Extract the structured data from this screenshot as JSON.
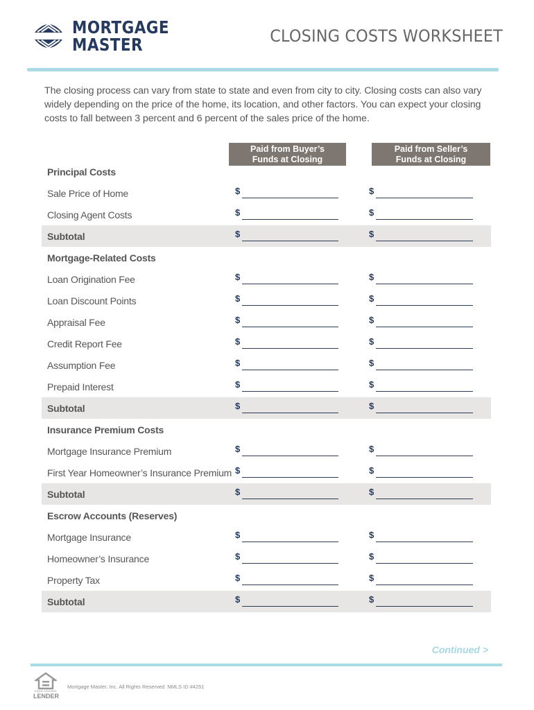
{
  "brand": {
    "line1": "MORTGAGE",
    "line2": "MASTER",
    "color": "#253a5e",
    "logo_icon": "globe-icon"
  },
  "document": {
    "title": "CLOSING COSTS WORKSHEET",
    "intro": "The closing process can vary from state to state and even from city to city. Closing costs can also vary widely depending on the price of the home, its location, and other factors. You can expect your closing costs to fall between 3 percent and 6 percent of the sales price of the home.",
    "accent_color": "#a9dbe6"
  },
  "columns": {
    "buyer": {
      "line1": "Paid from Buyer’s",
      "line2": "Funds at Closing"
    },
    "seller": {
      "line1": "Paid from Seller’s",
      "line2": "Funds at Closing"
    },
    "currency_symbol": "$"
  },
  "sections": [
    {
      "title": "Principal Costs",
      "items": [
        "Sale Price of Home",
        "Closing Agent Costs"
      ],
      "subtotal_label": "Subtotal"
    },
    {
      "title": "Mortgage-Related Costs",
      "items": [
        "Loan Origination Fee",
        "Loan Discount Points",
        "Appraisal Fee",
        "Credit Report Fee",
        "Assumption Fee",
        "Prepaid Interest"
      ],
      "subtotal_label": "Subtotal"
    },
    {
      "title": "Insurance Premium Costs",
      "items": [
        "Mortgage Insurance Premium",
        "First Year Homeowner’s Insurance Premium"
      ],
      "subtotal_label": "Subtotal"
    },
    {
      "title": "Escrow Accounts (Reserves)",
      "items": [
        "Mortgage Insurance",
        "Homeowner’s Insurance",
        "Property Tax"
      ],
      "subtotal_label": "Subtotal"
    }
  ],
  "footer": {
    "continued": "Continued >",
    "ehl_small": "EQUAL HOUSING",
    "ehl_big": "LENDER",
    "ehl_icon": "equal-housing-icon",
    "copyright": "Mortgage Master, Inc. All Rights Reserved. NMLS ID #4251"
  }
}
